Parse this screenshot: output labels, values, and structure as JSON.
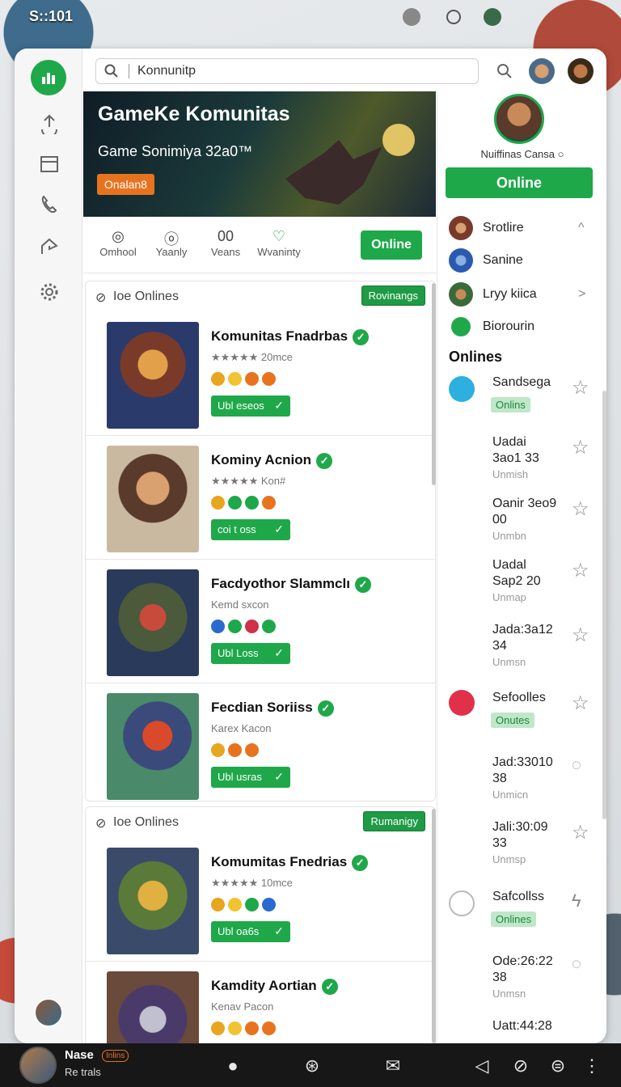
{
  "status": {
    "time": "S::101"
  },
  "search": {
    "value": "Konnunitp"
  },
  "hero": {
    "title": "GameKe Komunitas",
    "subtitle": "Game Sonimiya 32a0™",
    "tag": "Onalan8"
  },
  "stats": [
    {
      "value": "",
      "label": "Omhool"
    },
    {
      "value": "",
      "label": "Yaanly"
    },
    {
      "value": "00",
      "label": "Veans"
    },
    {
      "value": "",
      "label": "Wvaninty"
    }
  ],
  "online_label": "Online",
  "list1": {
    "title": "Ioe Onlines",
    "badge": "Rovinangs",
    "rows": [
      {
        "name": "Komunitas Fnadrbas",
        "sub": "★★★★★ 20mce",
        "btn": "Ubl eseos"
      },
      {
        "name": "Kominy Acnion",
        "sub": "★★★★★ Kon#",
        "btn": "coi t oss"
      },
      {
        "name": "Facdyothor Slammclı",
        "sub": "Kemd sxcon",
        "btn": "Ubl Loss"
      },
      {
        "name": "Fecdian Soriiss",
        "sub": "Karex Kacon",
        "btn": "Ubl usras"
      }
    ]
  },
  "list2": {
    "title": "Ioe Onlines",
    "badge": "Rumanigy",
    "rows": [
      {
        "name": "Komumitas Fnedrias",
        "sub": "★★★★★ 10mce",
        "btn": "Ubl oa6s"
      },
      {
        "name": "Kamdity Aortian",
        "sub": "Kenav Pacon",
        "btn": ""
      }
    ]
  },
  "profile": {
    "name": "Nuiffinas Cansa"
  },
  "side_menu": [
    {
      "label": "Srotlire",
      "end": "^"
    },
    {
      "label": "Sanine",
      "end": ""
    },
    {
      "label": "Lryy kiica",
      "end": ">"
    },
    {
      "label": "Biorourin",
      "end": ""
    }
  ],
  "side_section": "Onlines",
  "side_items": [
    {
      "title": "Sandsega",
      "pill": "Onlins",
      "sub": ""
    },
    {
      "title": "Uadai 3ao1 33",
      "pill": "",
      "sub": "Unmish"
    },
    {
      "title": "Oanir 3eo9 00",
      "pill": "",
      "sub": "Unmbn"
    },
    {
      "title": "Uadal Sap2 20",
      "pill": "",
      "sub": "Unmap"
    },
    {
      "title": "Jada:3a12 34",
      "pill": "",
      "sub": "Unmsn"
    },
    {
      "title": "Sefoolles",
      "pill": "Onutes",
      "sub": ""
    },
    {
      "title": "Jad:33010 38",
      "pill": "",
      "sub": "Unmicn"
    },
    {
      "title": "Jali:30:09 33",
      "pill": "",
      "sub": "Unmsp"
    },
    {
      "title": "Safcollss",
      "pill": "Onlines",
      "sub": ""
    },
    {
      "title": "Ode:26:22 38",
      "pill": "",
      "sub": "Unmsn"
    },
    {
      "title": "Uatt:44:28",
      "pill": "",
      "sub": ""
    }
  ],
  "user": {
    "name": "Nase",
    "badge": "Inlins",
    "status": "Re trals"
  },
  "colors": {
    "accent": "#1fa84a",
    "orange": "#e8731f",
    "navbar": "#171717"
  }
}
